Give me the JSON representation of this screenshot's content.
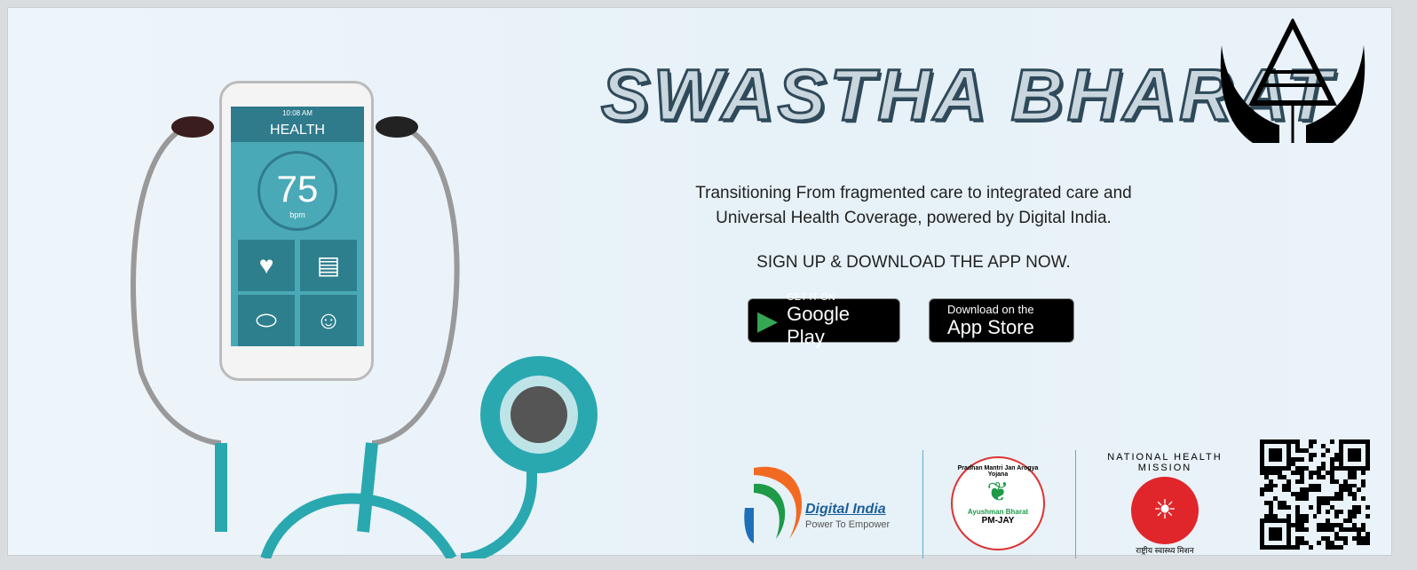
{
  "title": "SWASTHA BHARAT",
  "tagline": [
    "Transitioning From fragmented care to integrated care and",
    "Universal Health Coverage, powered by Digital India."
  ],
  "cta": "SIGN UP & DOWNLOAD THE APP NOW.",
  "google_play": {
    "small": "GET IT ON",
    "big": "Google Play"
  },
  "app_store": {
    "small": "Download on the",
    "big": "App Store"
  },
  "phone": {
    "time": "10:08 AM",
    "header": "HEALTH",
    "bpm_value": "75",
    "bpm_unit": "bpm"
  },
  "logos": {
    "digital_india": {
      "name": "Digital India",
      "slogan": "Power To Empower"
    },
    "pmjay": {
      "ring": "Pradhan Mantri Jan Arogya Yojana",
      "name": "Ayushman Bharat",
      "sub": "PM-JAY"
    },
    "nhm": {
      "ring": "NATIONAL HEALTH MISSION",
      "hindi": "राष्ट्रीय स्वास्थ्य मिशन"
    }
  },
  "colors": {
    "teal": "#2aa8b0",
    "orange": "#f26a21",
    "green": "#1e9a48",
    "red": "#e0262b"
  }
}
